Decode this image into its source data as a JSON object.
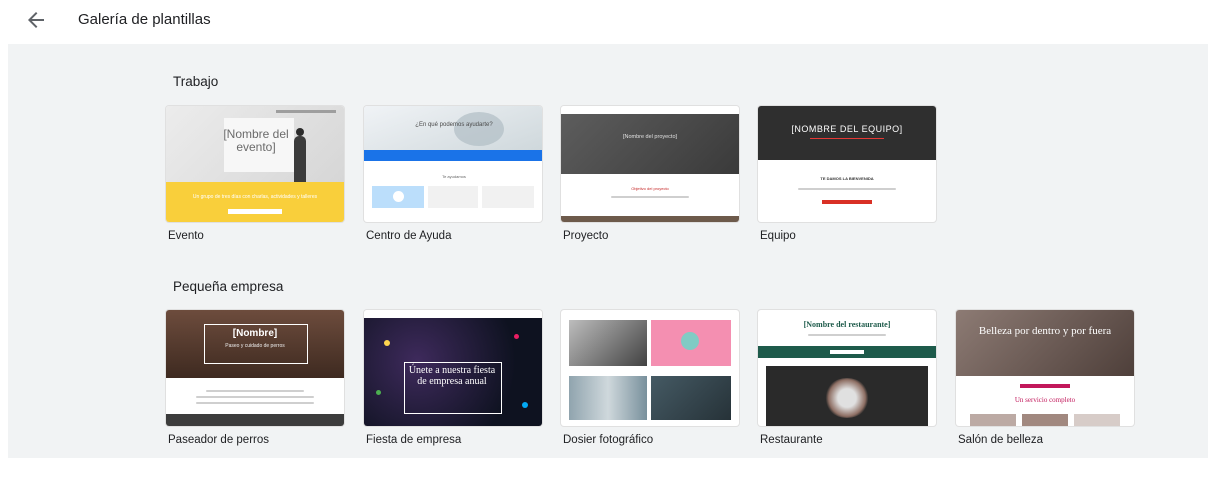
{
  "header": {
    "title": "Galería de plantillas",
    "back_icon": "arrow-left-icon"
  },
  "sections": [
    {
      "title": "Trabajo",
      "templates": [
        {
          "label": "Evento",
          "preview_title": "[Nombre del evento]",
          "preview_text": "Un grupo de tres días con charlas, actividades y talleres"
        },
        {
          "label": "Centro de Ayuda",
          "preview_title": "¿En qué podemos ayudarte?",
          "preview_text": "Te ayudamos"
        },
        {
          "label": "Proyecto",
          "preview_title": "[Nombre del proyecto]",
          "preview_text": "Objetivo del proyecto"
        },
        {
          "label": "Equipo",
          "preview_title": "[NOMBRE DEL EQUIPO]",
          "preview_text": "TE DAMOS LA BIENVENIDA"
        }
      ]
    },
    {
      "title": "Pequeña empresa",
      "templates": [
        {
          "label": "Paseador de perros",
          "preview_title": "[Nombre]",
          "preview_text": "Paseo y cuidado de perros"
        },
        {
          "label": "Fiesta de empresa",
          "preview_title": "Únete a nuestra fiesta de empresa anual",
          "preview_text": ""
        },
        {
          "label": "Dosier fotográfico",
          "preview_title": "",
          "preview_text": ""
        },
        {
          "label": "Restaurante",
          "preview_title": "[Nombre del restaurante]",
          "preview_text": ""
        },
        {
          "label": "Salón de belleza",
          "preview_title": "Belleza por dentro y por fuera",
          "preview_text": "Un servicio completo"
        }
      ]
    }
  ],
  "colors": {
    "content_bg": "#f1f3f4",
    "event_yellow": "#f9cf3b",
    "help_blue": "#1a73e8",
    "team_red": "#d93025",
    "restaurant_green": "#1e5b4b",
    "salon_pink": "#c2185b"
  }
}
